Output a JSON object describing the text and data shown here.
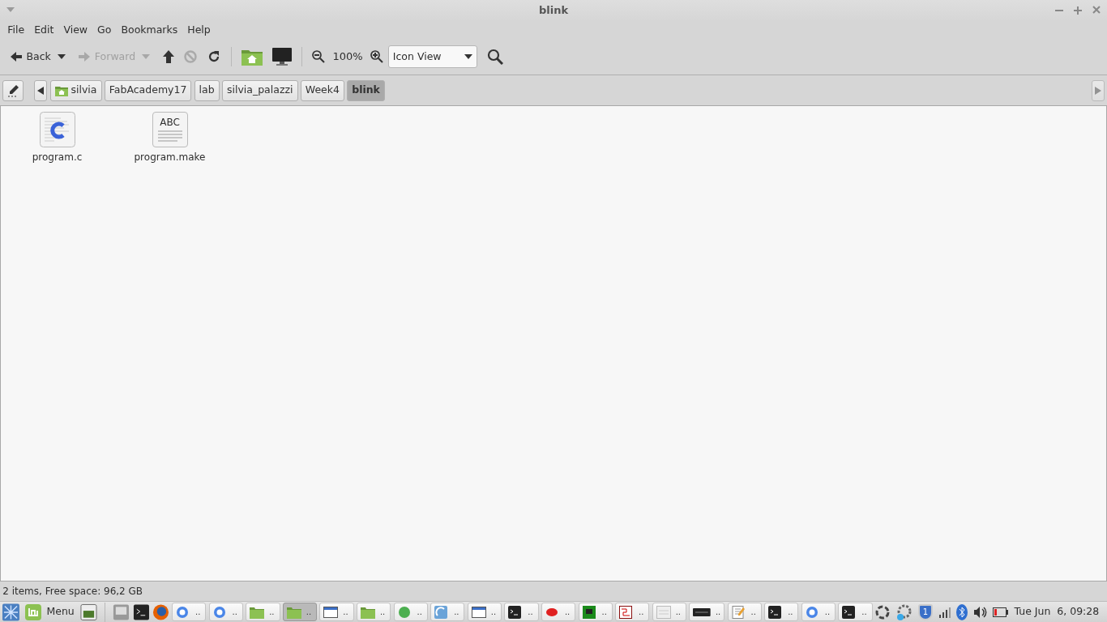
{
  "window": {
    "title": "blink"
  },
  "menu": [
    "File",
    "Edit",
    "View",
    "Go",
    "Bookmarks",
    "Help"
  ],
  "toolbar": {
    "back": {
      "label": "Back",
      "disabled": false
    },
    "forward": {
      "label": "Forward",
      "disabled": true
    },
    "stop_disabled": true,
    "zoom": "100%",
    "view_select": {
      "value": "Icon View"
    }
  },
  "path": [
    {
      "label": "silvia",
      "kind": "home",
      "selected": false
    },
    {
      "label": "FabAcademy17",
      "kind": "dir",
      "selected": false
    },
    {
      "label": "lab",
      "kind": "dir",
      "selected": false
    },
    {
      "label": "silvia_palazzi",
      "kind": "dir",
      "selected": false
    },
    {
      "label": "Week4",
      "kind": "dir",
      "selected": false
    },
    {
      "label": "blink",
      "kind": "dir",
      "selected": true
    }
  ],
  "files": [
    {
      "name": "program.c",
      "kind": "c"
    },
    {
      "name": "program.make",
      "kind": "text",
      "icon_text": "ABC"
    }
  ],
  "status_bar": "2 items, Free space: 96,2 GB",
  "taskbar": {
    "menu_label": "Menu",
    "windows": [
      {
        "label": "..",
        "kind": "browser",
        "selected": false
      },
      {
        "label": "..",
        "kind": "browser",
        "selected": false
      },
      {
        "label": "..",
        "kind": "folder",
        "selected": false
      },
      {
        "label": "..",
        "kind": "folder",
        "selected": true
      },
      {
        "label": "..",
        "kind": "window",
        "selected": false
      },
      {
        "label": "..",
        "kind": "folder",
        "selected": false
      },
      {
        "label": "..",
        "kind": "globe",
        "selected": false
      },
      {
        "label": "..",
        "kind": "app",
        "selected": false
      },
      {
        "label": "..",
        "kind": "window",
        "selected": false
      },
      {
        "label": "..",
        "kind": "terminal",
        "selected": false
      },
      {
        "label": "..",
        "kind": "bug",
        "selected": false
      },
      {
        "label": "..",
        "kind": "board",
        "selected": false
      },
      {
        "label": "..",
        "kind": "schematic",
        "selected": false
      },
      {
        "label": "..",
        "kind": "doc",
        "selected": false
      },
      {
        "label": "..",
        "kind": "device",
        "selected": false
      },
      {
        "label": "..",
        "kind": "editor",
        "selected": false
      },
      {
        "label": "..",
        "kind": "terminal",
        "selected": false
      },
      {
        "label": "..",
        "kind": "browser",
        "selected": false
      },
      {
        "label": "..",
        "kind": "terminal",
        "selected": false
      }
    ],
    "update_badge": "1",
    "clock": "Tue Jun  6, 09:28"
  }
}
